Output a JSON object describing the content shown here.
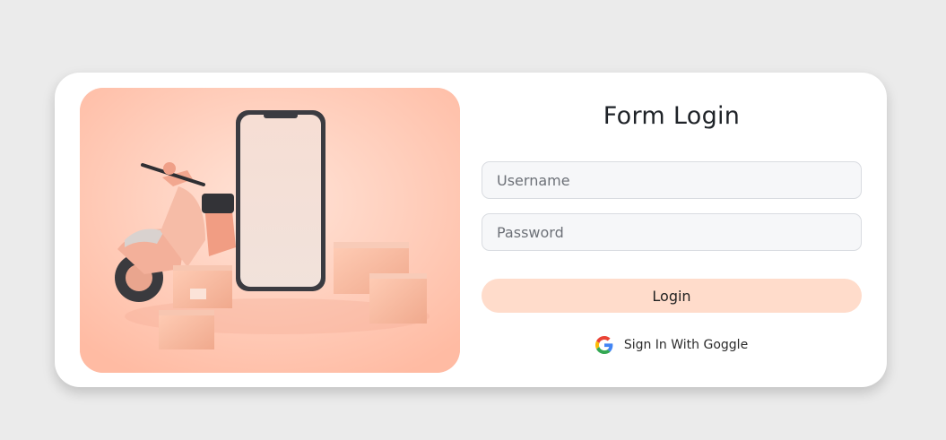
{
  "form": {
    "title": "Form Login",
    "username": {
      "placeholder": "Username",
      "value": ""
    },
    "password": {
      "placeholder": "Password",
      "value": ""
    },
    "login_label": "Login",
    "google_label": "Sign In With Goggle",
    "google_icon": "google-icon"
  },
  "hero": {
    "image": "delivery-illustration",
    "colors": {
      "background": "#ffcab6",
      "accent": "#ffdccb"
    }
  }
}
